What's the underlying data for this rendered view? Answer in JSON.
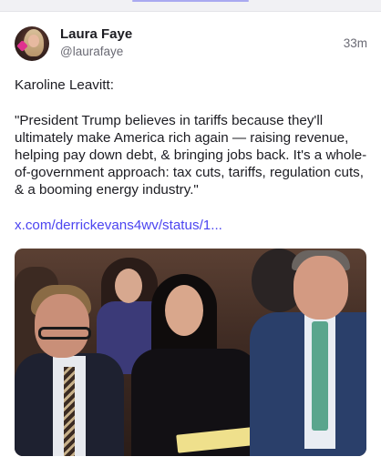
{
  "post": {
    "author_name": "Laura Faye",
    "author_handle": "@laurafaye",
    "time_ago": "33m",
    "intro": "Karoline Leavitt:",
    "quote": "\"President Trump believes in tariffs because they'll ultimately make America rich again — raising revenue, helping pay down debt, & bringing jobs back. It's a whole-of-government approach: tax cuts, tariffs, regulation cuts, & a booming energy industry.\"",
    "link_text": "x.com/derrickevans4wv/status/1..."
  }
}
